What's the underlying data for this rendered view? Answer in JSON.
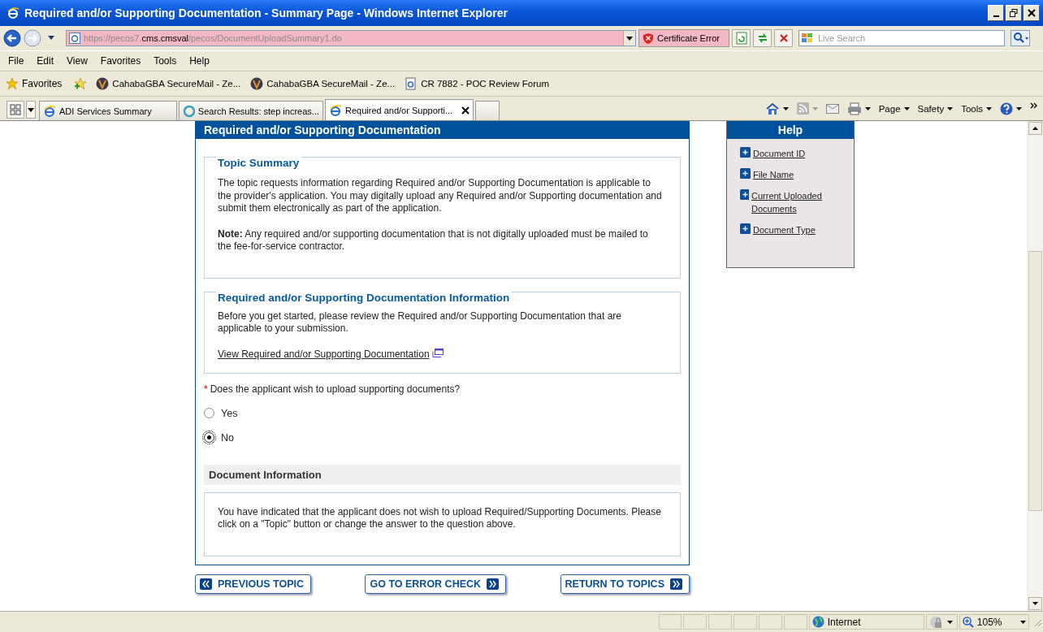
{
  "window": {
    "title": "Required and/or Supporting Documentation - Summary Page - Windows Internet Explorer"
  },
  "address_bar": {
    "url_prefix": "https://pecos7.",
    "url_domain": "cms.cmsval",
    "url_suffix": "/pecos/DocumentUploadSummary1.do",
    "certificate_error": "Certificate Error",
    "search_placeholder": "Live Search"
  },
  "menu": [
    "File",
    "Edit",
    "View",
    "Favorites",
    "Tools",
    "Help"
  ],
  "favorites_bar": {
    "label": "Favorites",
    "items": [
      {
        "label": "CahabaGBA SecureMail - Ze...",
        "kind": "mail"
      },
      {
        "label": "CahabaGBA SecureMail - Ze...",
        "kind": "mail"
      },
      {
        "label": "CR 7882 - POC Review Forum",
        "kind": "page"
      }
    ]
  },
  "tabs": [
    {
      "label": "ADI Services Summary",
      "selected": false,
      "kind": "ie"
    },
    {
      "label": "Search Results: step increas...",
      "kind": "loading",
      "selected": false
    },
    {
      "label": "Required and/or Supporti...",
      "kind": "ie",
      "selected": true
    }
  ],
  "command_bar": [
    "Page",
    "Safety",
    "Tools"
  ],
  "page": {
    "header": "Required and/or Supporting Documentation",
    "topic_summary": {
      "title": "Topic Summary",
      "text": "The topic requests information regarding Required and/or Supporting Documentation is applicable to the provider's application. You may digitally upload any Required and/or Supporting documentation and submit them electronically as part of the application.",
      "note": "**Note:** Any required and/or supporting documentation that is not digitally uploaded must be mailed to the fee-for-service contractor."
    },
    "info": {
      "title": "Required and/or Supporting Documentation Information",
      "text": "Before you get started, please review the Required and/or Supporting Documentation that are applicable to your submission.",
      "link": "View Required and/or Supporting Documentation"
    },
    "question": {
      "required_mark": "*",
      "text": "Does the applicant wish to upload supporting documents?",
      "options": [
        {
          "label": "Yes",
          "selected": false
        },
        {
          "label": "No",
          "selected": true
        }
      ]
    },
    "document_information": {
      "title": "Document Information",
      "text": "You have indicated that the applicant does not wish to upload Required/Supporting Documents. Please click on a \"Topic\" button or change the answer to the question above."
    },
    "buttons": [
      {
        "label": "PREVIOUS TOPIC",
        "kind": "back"
      },
      {
        "label": "GO TO ERROR CHECK",
        "kind": "forward"
      },
      {
        "label": "RETURN TO TOPICS",
        "kind": "forward"
      }
    ]
  },
  "help": {
    "title": "Help",
    "items": [
      "Document ID",
      "File Name",
      "Current Uploaded Documents",
      "Document Type"
    ]
  },
  "status_bar": {
    "zone": "Internet",
    "zoom": "105%"
  }
}
